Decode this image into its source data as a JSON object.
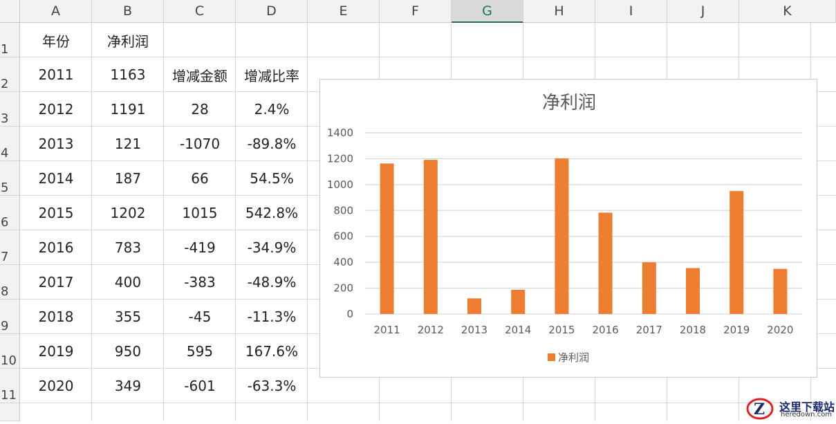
{
  "sheet": {
    "columns": [
      "A",
      "B",
      "C",
      "D",
      "E",
      "F",
      "G",
      "H",
      "I",
      "J",
      "K"
    ],
    "selected_column": "G",
    "rows": [
      "1",
      "2",
      "3",
      "4",
      "5",
      "6",
      "7",
      "8",
      "9",
      "10",
      "11"
    ],
    "cells": {
      "A1": "年份",
      "B1": "净利润",
      "A2": "2011",
      "B2": "1163",
      "C2": "增减金额",
      "D2": "增减比率",
      "A3": "2012",
      "B3": "1191",
      "C3": "28",
      "D3": "2.4%",
      "A4": "2013",
      "B4": "121",
      "C4": "-1070",
      "D4": "-89.8%",
      "A5": "2014",
      "B5": "187",
      "C5": "66",
      "D5": "54.5%",
      "A6": "2015",
      "B6": "1202",
      "C6": "1015",
      "D6": "542.8%",
      "A7": "2016",
      "B7": "783",
      "C7": "-419",
      "D7": "-34.9%",
      "A8": "2017",
      "B8": "400",
      "C8": "-383",
      "D8": "-48.9%",
      "A9": "2018",
      "B9": "355",
      "C9": "-45",
      "D9": "-11.3%",
      "A10": "2019",
      "B10": "950",
      "C10": "595",
      "D10": "167.6%",
      "A11": "2020",
      "B11": "349",
      "C11": "-601",
      "D11": "-63.3%"
    }
  },
  "chart_data": {
    "type": "bar",
    "title": "净利润",
    "categories": [
      "2011",
      "2012",
      "2013",
      "2014",
      "2015",
      "2016",
      "2017",
      "2018",
      "2019",
      "2020"
    ],
    "series": [
      {
        "name": "净利润",
        "values": [
          1163,
          1191,
          121,
          187,
          1202,
          783,
          400,
          355,
          950,
          349
        ],
        "color": "#ed7d31"
      }
    ],
    "ylim": [
      0,
      1400
    ],
    "yticks": [
      "0",
      "200",
      "400",
      "600",
      "800",
      "1000",
      "1200",
      "1400"
    ],
    "grid": true,
    "legend": "bottom"
  },
  "watermark": {
    "title": "这里下载站",
    "url": "heredown.com"
  },
  "colors": {
    "accent": "#217346",
    "bar": "#ed7d31",
    "grid": "#d9d9d9"
  }
}
